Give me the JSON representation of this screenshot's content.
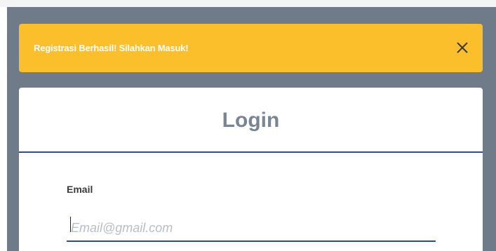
{
  "alert": {
    "message": "Registrasi Berhasil! Silahkan Masuk!",
    "close_icon": "close-icon",
    "color": "#fbbf2c"
  },
  "login": {
    "title": "Login",
    "email_label": "Email",
    "email_placeholder": "Email@gmail.com",
    "email_value": ""
  },
  "colors": {
    "backdrop": "#6f7b88",
    "accent": "#2a4a9f",
    "title": "#7a8593"
  }
}
